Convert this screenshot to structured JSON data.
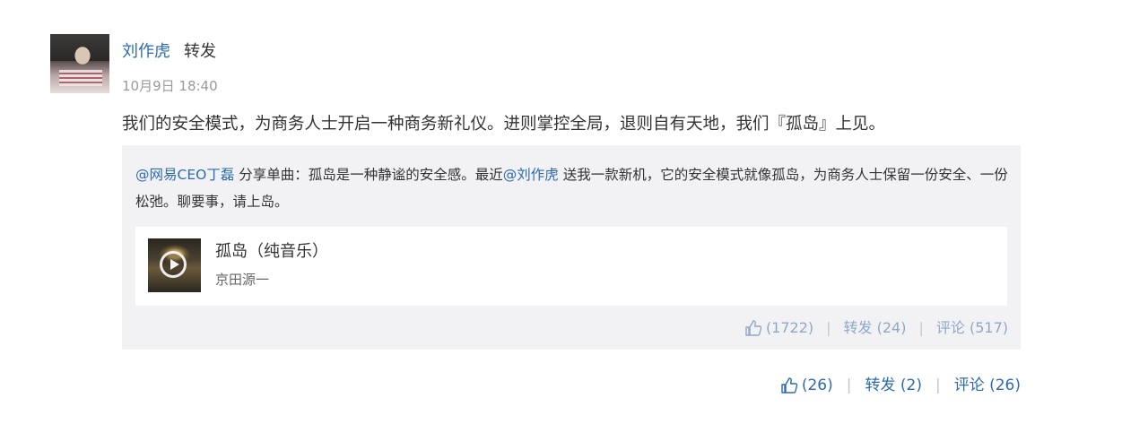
{
  "post": {
    "author": "刘作虎",
    "action": "转发",
    "time": "10月9日 18:40",
    "text": "我们的安全模式，为商务人士开启一种商务新礼仪。进则掌控全局，退则自有天地，我们『孤岛』上见。"
  },
  "repost": {
    "mention_author": "@网易CEO丁磊",
    "text_part1": " 分享单曲：孤岛是一种静谧的安全感。最近",
    "mention2": "@刘作虎",
    "text_part2": " 送我一款新机，它的安全模式就像孤岛，为商务人士保留一份安全、一份松弛。聊要事，请上岛。",
    "music": {
      "title": "孤岛（纯音乐）",
      "artist": "京田源一"
    },
    "stats": {
      "likes": "(1722)",
      "repost_label": "转发 (24)",
      "comment_label": "评论 (517)"
    }
  },
  "footer": {
    "likes": "(26)",
    "repost_label": "转发 (2)",
    "comment_label": "评论 (26)"
  },
  "icons": {
    "like": "thumbs-up-icon",
    "play": "play-icon"
  },
  "colors": {
    "link": "#2c6bb0",
    "muted_link": "#8fa8c8",
    "box_bg": "#f2f2f5"
  }
}
